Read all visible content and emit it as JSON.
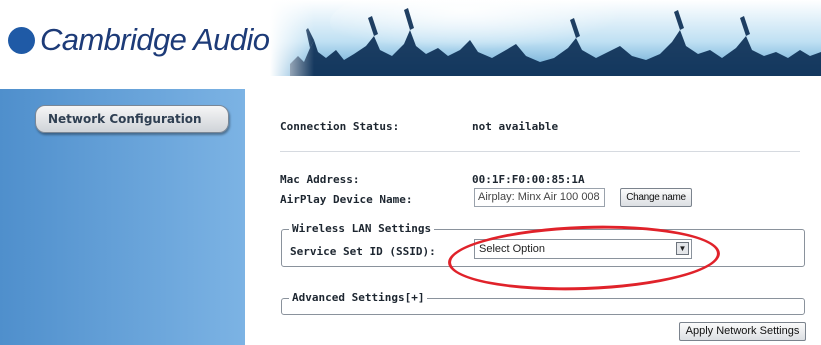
{
  "brand": {
    "name": "Cambridge Audio"
  },
  "sidebar": {
    "items": [
      {
        "label": "Network Configuration"
      }
    ]
  },
  "connection": {
    "label": "Connection Status:",
    "value": "not available"
  },
  "mac": {
    "label": "Mac Address:",
    "value": "00:1F:F0:00:85:1A"
  },
  "airplay": {
    "label": "AirPlay Device Name:",
    "value": "Airplay: Minx Air 100  008",
    "button": "Change name"
  },
  "wireless": {
    "legend": "Wireless LAN Settings",
    "ssid_label": "Service Set ID (SSID):",
    "ssid_selected": "Select Option",
    "dropdown_icon": "chevron-down-icon"
  },
  "advanced": {
    "legend": "Advanced Settings[+]"
  },
  "apply": {
    "label": "Apply Network Settings"
  },
  "colors": {
    "sidebar": "#6aa3d8",
    "highlight_circle": "#e0222a",
    "brand": "#1d3b78"
  }
}
